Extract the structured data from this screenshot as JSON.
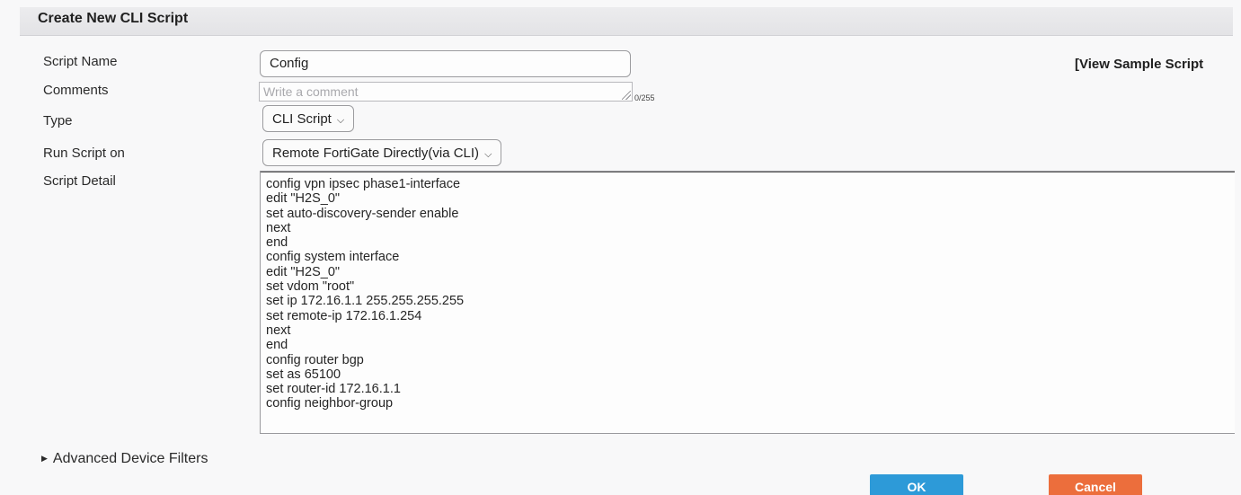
{
  "header": {
    "title": "Create New CLI Script"
  },
  "form": {
    "script_name": {
      "label": "Script Name",
      "value": "Config"
    },
    "view_sample_link": "[View Sample Script",
    "comments": {
      "label": "Comments",
      "placeholder": "Write a comment",
      "counter": "0/255"
    },
    "type": {
      "label": "Type",
      "value": "CLI Script"
    },
    "run_script_on": {
      "label": "Run Script on",
      "value": "Remote FortiGate Directly(via CLI)"
    },
    "script_detail": {
      "label": "Script Detail",
      "lines": [
        "config vpn ipsec phase1-interface",
        "edit \"H2S_0\"",
        "set auto-discovery-sender enable",
        "next",
        "end",
        "config system interface",
        "edit \"H2S_0\"",
        "set vdom \"root\"",
        "set ip 172.16.1.1 255.255.255.255",
        "set remote-ip 172.16.1.254",
        "next",
        "end",
        "config router bgp",
        "set as 65100",
        "set router-id 172.16.1.1",
        "config neighbor-group"
      ]
    }
  },
  "advanced_filters": {
    "label": "Advanced Device Filters"
  },
  "buttons": {
    "ok": "OK",
    "cancel": "Cancel"
  },
  "colors": {
    "ok": "#2d9ad8",
    "cancel": "#ec6e3c"
  },
  "icons": {
    "dropdown": "chevron-down-icon",
    "expand": "triangle-right-icon",
    "resize": "resize-grip-icon"
  }
}
